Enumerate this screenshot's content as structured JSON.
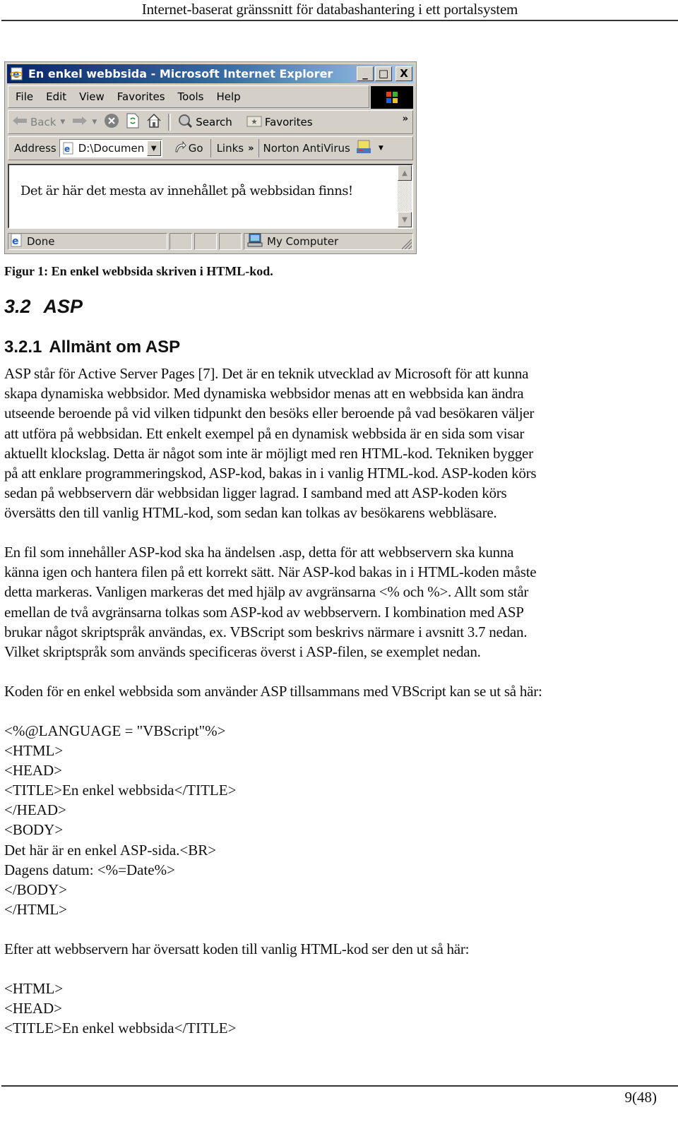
{
  "header": {
    "running_title": "Internet-baserat gränssnitt för databashantering i ett portalsystem"
  },
  "figure": {
    "browser": {
      "window_title": "En enkel webbsida - Microsoft Internet Explorer",
      "window_controls": {
        "minimize": "_",
        "maximize": "□",
        "close": "X"
      },
      "menu": [
        "File",
        "Edit",
        "View",
        "Favorites",
        "Tools",
        "Help"
      ],
      "toolbar": {
        "back": "Back",
        "search": "Search",
        "favorites": "Favorites",
        "more": "»"
      },
      "address": {
        "label": "Address",
        "value": "D:\\Documen",
        "go": "Go",
        "links": "Links",
        "links_more": "»",
        "norton": "Norton AntiVirus"
      },
      "page_content": "Det är här det mesta av innehållet på webbsidan finns!",
      "status": {
        "text": "Done",
        "zone": "My Computer"
      }
    },
    "caption": "Figur 1: En enkel webbsida skriven i HTML-kod."
  },
  "section": {
    "number": "3.2",
    "title": "ASP"
  },
  "subsection": {
    "number": "3.2.1",
    "title": "Allmänt om ASP"
  },
  "paragraphs": {
    "p1": [
      "ASP står för Active Server Pages [7]. Det är en teknik utvecklad av Microsoft för att kunna",
      "skapa dynamiska webbsidor. Med dynamiska webbsidor menas att en webbsida kan ändra",
      "utseende beroende på vid vilken tidpunkt den besöks eller beroende på vad besökaren väljer",
      "att utföra på webbsidan. Ett enkelt exempel på en dynamisk webbsida är en sida som visar",
      "aktuellt klockslag. Detta är något som inte är möjligt med ren HTML-kod. Tekniken bygger",
      "på att enklare programmeringskod, ASP-kod, bakas in i vanlig HTML-kod. ASP-koden körs",
      "sedan på webbservern där webbsidan ligger lagrad. I samband med att ASP-koden körs",
      "översätts den till vanlig HTML-kod, som sedan kan tolkas av besökarens webbläsare."
    ],
    "p2": [
      "En fil som innehåller ASP-kod ska ha ändelsen .asp, detta för att webbservern ska kunna",
      "känna igen och hantera filen på ett korrekt sätt. När ASP-kod bakas in i HTML-koden måste",
      "detta markeras. Vanligen markeras det med hjälp av avgränsarna <% och %>. Allt som står",
      "emellan de två avgränsarna tolkas som ASP-kod av webbservern. I kombination med ASP",
      "brukar något skriptspråk användas, ex. VBScript som beskrivs närmare i avsnitt 3.7 nedan.",
      "Vilket skriptspråk som används specificeras överst i ASP-filen, se exemplet nedan."
    ],
    "p3": "Koden för en enkel webbsida som använder ASP tillsammans med VBScript kan se ut så här:",
    "p4": "Efter att webbservern har översatt koden till vanlig HTML-kod ser den ut så här:"
  },
  "code_asp": [
    "<%@LANGUAGE = \"VBScript\"%>",
    "<HTML>",
    "<HEAD>",
    "<TITLE>En enkel webbsida</TITLE>",
    "</HEAD>",
    "<BODY>",
    "Det här är en enkel ASP-sida.<BR>",
    "Dagens datum: <%=Date%>",
    "</BODY>",
    "</HTML>"
  ],
  "code_html": [
    "<HTML>",
    "<HEAD>",
    "<TITLE>En enkel webbsida</TITLE>"
  ],
  "footer": {
    "page_number": "9(48)"
  },
  "icons": {
    "app": "ie-logo-icon",
    "back": "back-arrow-icon",
    "forward": "forward-arrow-icon",
    "stop": "stop-icon",
    "refresh": "refresh-icon",
    "home": "home-icon",
    "search": "search-icon",
    "favorites": "favorites-icon",
    "go": "go-arrow-icon",
    "norton": "norton-icon",
    "status": "page-done-icon",
    "zone": "my-computer-icon",
    "throbber": "windows-logo-icon"
  }
}
